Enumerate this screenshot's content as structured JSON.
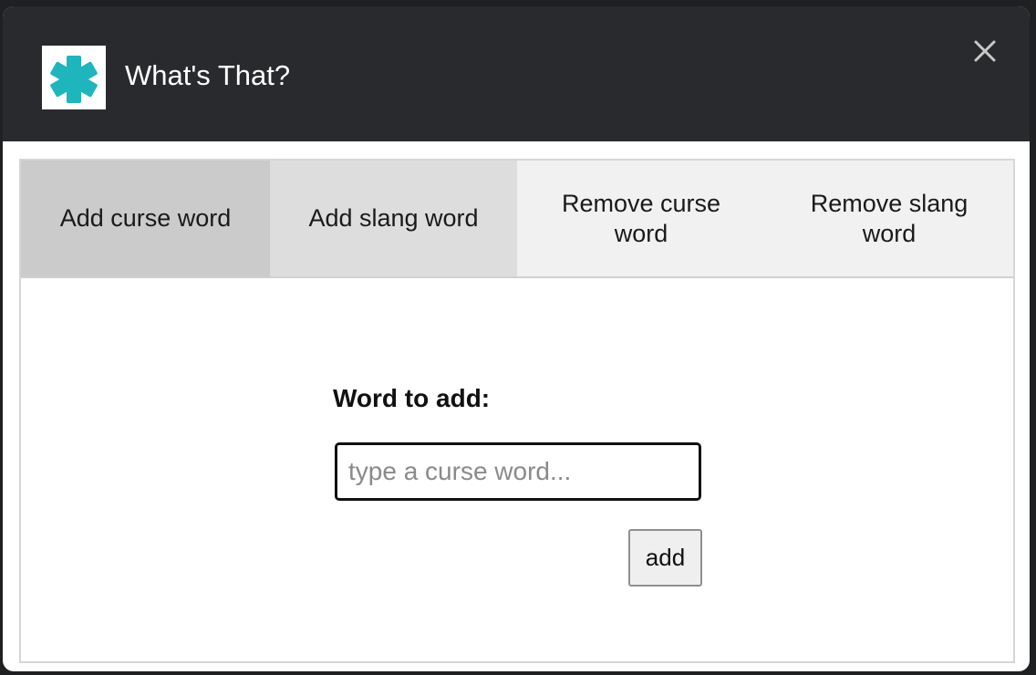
{
  "window": {
    "title": "What's That?",
    "icon": "asterisk-logo-icon",
    "close_icon": "close-icon"
  },
  "colors": {
    "header_bg": "#292a2d",
    "logo_teal": "#1fb5bd",
    "tab_active": "#cbcbcb",
    "tab_hover": "#dddddd",
    "tab_inactive": "#f1f1f1"
  },
  "tabs": [
    {
      "label": "Add curse word",
      "state": "selected"
    },
    {
      "label": "Add slang word",
      "state": "hover"
    },
    {
      "label": "Remove curse word",
      "state": "normal"
    },
    {
      "label": "Remove slang word",
      "state": "normal"
    }
  ],
  "form": {
    "label": "Word to add:",
    "input_value": "",
    "input_placeholder": "type a curse word...",
    "submit_label": "add"
  }
}
